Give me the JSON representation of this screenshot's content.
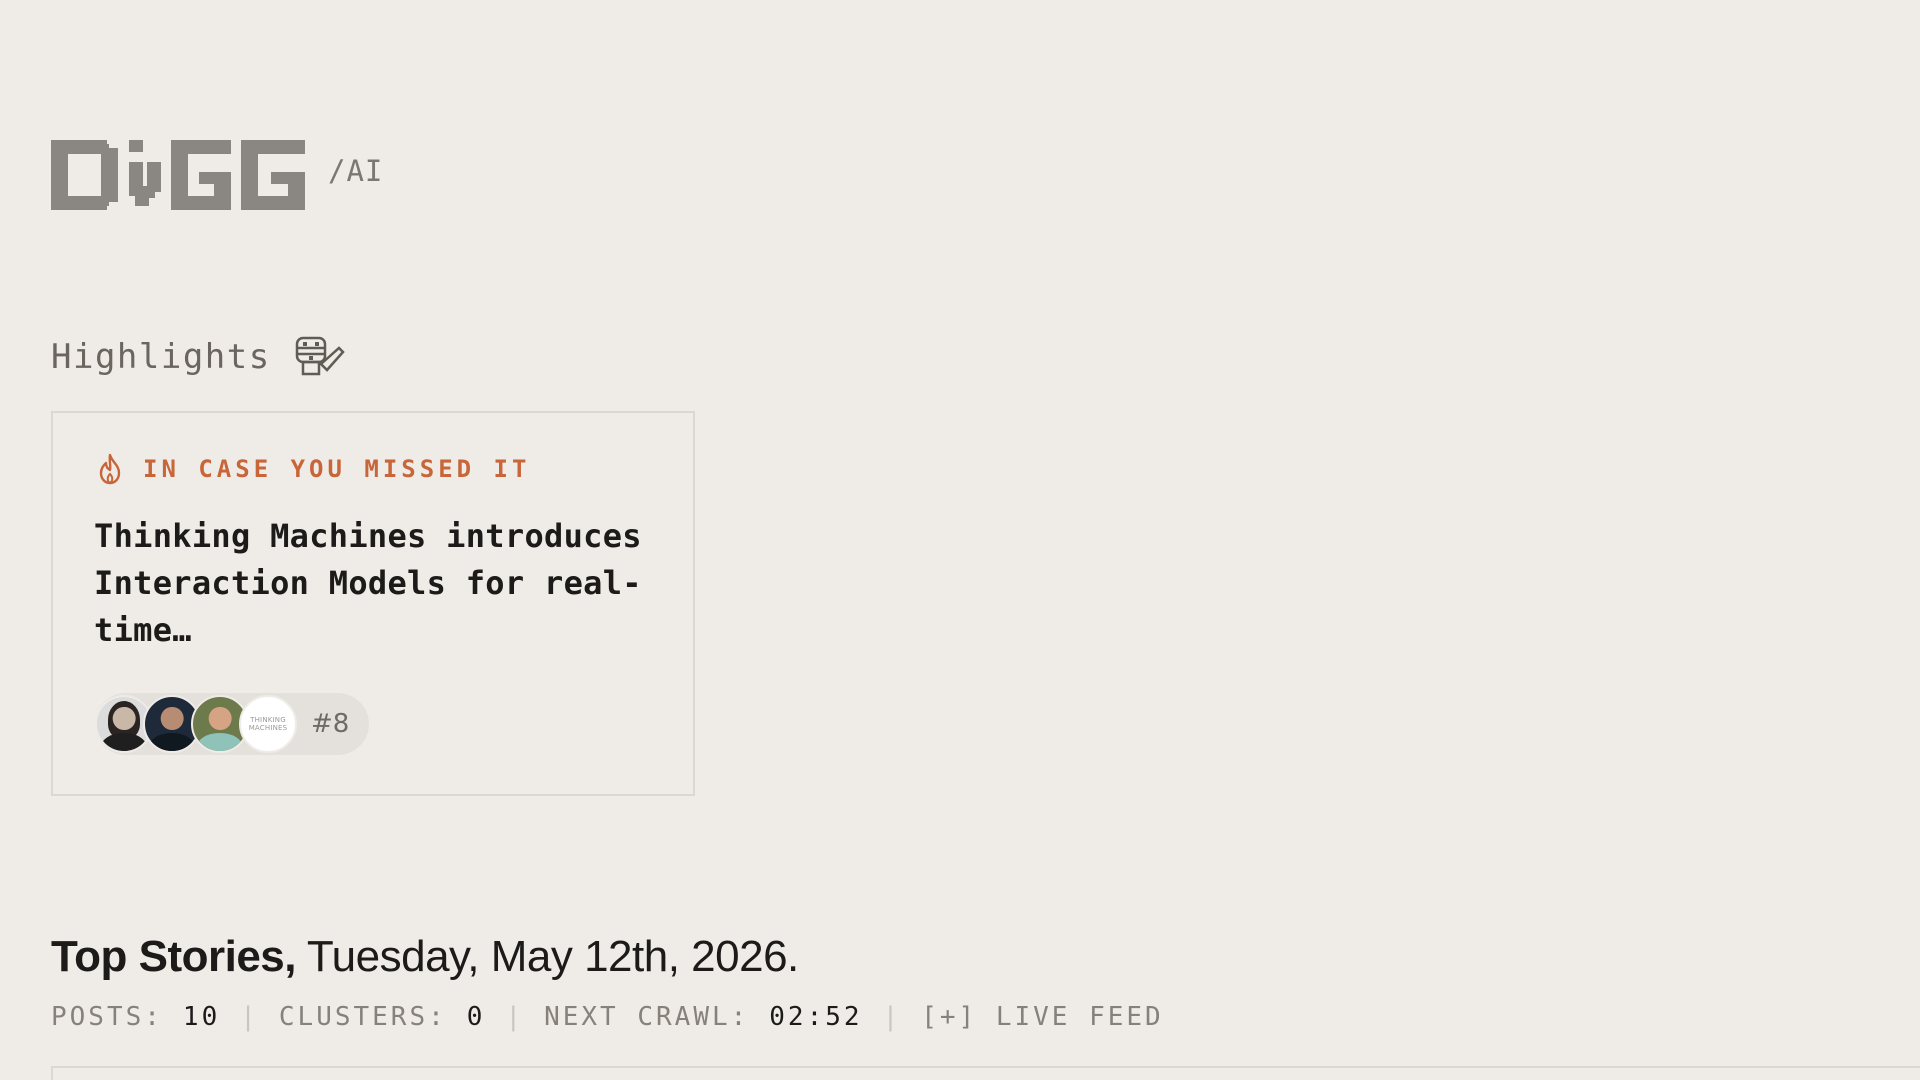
{
  "header": {
    "logo_icon": "digg-pixel-logo",
    "logo_suffix": "/AI"
  },
  "highlights": {
    "title": "Highlights",
    "title_icon": "pixel-mascot-icon",
    "card": {
      "tag_icon": "flame-icon",
      "tag_label": "IN CASE YOU MISSED IT",
      "title": "Thinking Machines introduces Interaction Models for real-time…",
      "avatars": [
        {
          "icon": "avatar-woman"
        },
        {
          "icon": "avatar-man-dark"
        },
        {
          "icon": "avatar-man-smiling"
        },
        {
          "icon": "avatar-thinking-machines-logo",
          "text": "THINKING MACHINES"
        }
      ],
      "rank": "#8"
    }
  },
  "top_stories": {
    "bold_label": "Top Stories,",
    "date": "Tuesday, May 12th, 2026."
  },
  "stats": {
    "posts_label": "POSTS:",
    "posts_value": "10",
    "clusters_label": "CLUSTERS:",
    "clusters_value": "0",
    "next_crawl_label": "NEXT CRAWL:",
    "next_crawl_value": "02:52",
    "live_feed_label": "[+] LIVE FEED",
    "separator": "|"
  },
  "colors": {
    "background": "#efece7",
    "accent_orange": "#c8663a",
    "logo_gray": "#8a8782",
    "text_dark": "#1c1b1a",
    "text_muted": "#86827b",
    "border": "#dcd8d1"
  }
}
